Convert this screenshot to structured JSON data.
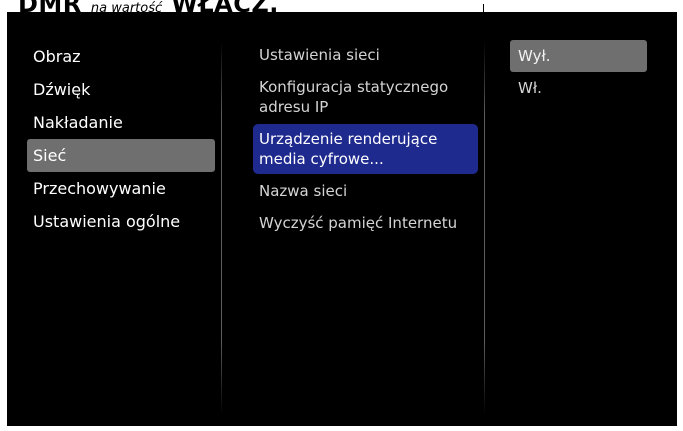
{
  "doc_header": {
    "bold_left": "DMR",
    "small_text": "na wartość",
    "bold_right": "WŁĄCZ."
  },
  "menu": {
    "main": [
      {
        "label": "Obraz",
        "selected": false
      },
      {
        "label": "Dźwięk",
        "selected": false
      },
      {
        "label": "Nakładanie",
        "selected": false
      },
      {
        "label": "Sieć",
        "selected": true
      },
      {
        "label": "Przechowywanie",
        "selected": false
      },
      {
        "label": "Ustawienia ogólne",
        "selected": false
      }
    ],
    "sub": [
      {
        "label": "Ustawienia sieci"
      },
      {
        "label": "Konfiguracja statycznego adresu IP"
      },
      {
        "label": "Urządzenie renderujące media cyfrowe...",
        "highlighted": true
      },
      {
        "label": "Nazwa sieci"
      },
      {
        "label": "Wyczyść pamięć Internetu"
      }
    ],
    "options": [
      {
        "label": "Wył.",
        "selected": true
      },
      {
        "label": "Wł.",
        "selected": false
      }
    ]
  },
  "colors": {
    "selection_gray": "#6f6f6f",
    "highlight_blue": "#1f2a8f",
    "background": "#000000"
  }
}
